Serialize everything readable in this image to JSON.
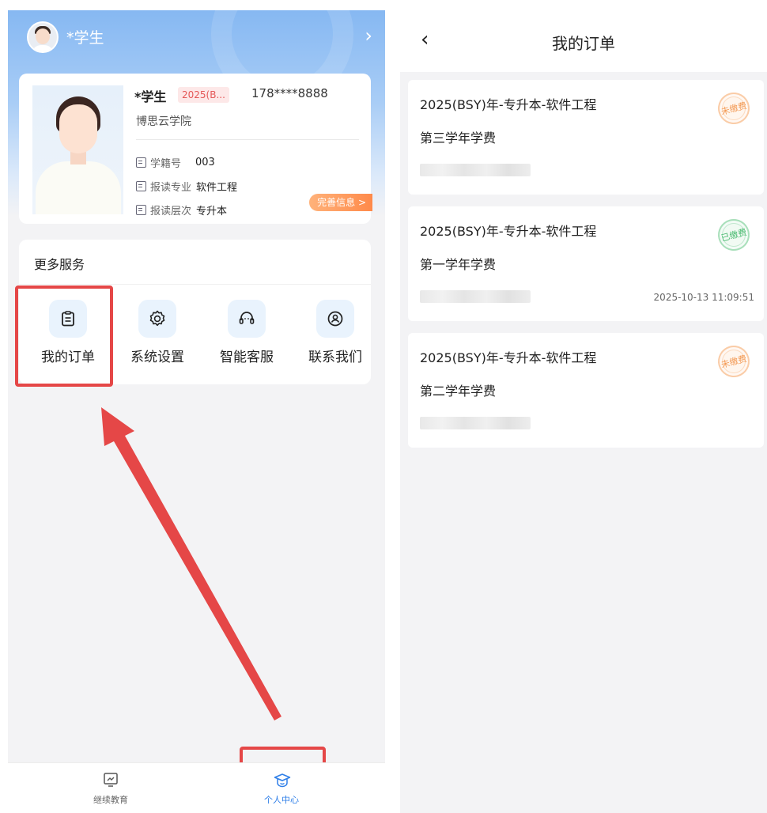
{
  "left": {
    "header": {
      "user_name": "*学生",
      "arrow": "›"
    },
    "profile": {
      "name": "*学生",
      "tag": "2025(B...",
      "phone": "178****8888",
      "school": "博思云学院",
      "rows": [
        {
          "label": "学籍号",
          "value": "003"
        },
        {
          "label": "报读专业",
          "value": "软件工程"
        },
        {
          "label": "报读层次",
          "value": "专升本"
        }
      ],
      "complete_button": "完善信息 >"
    },
    "services": {
      "title": "更多服务",
      "items": [
        {
          "label": "我的订单",
          "icon": "clipboard-icon"
        },
        {
          "label": "系统设置",
          "icon": "gear-icon"
        },
        {
          "label": "智能客服",
          "icon": "headset-icon"
        },
        {
          "label": "联系我们",
          "icon": "contact-icon"
        }
      ]
    },
    "tabbar": {
      "tabs": [
        {
          "label": "继续教育",
          "icon": "monitor-icon",
          "active": false
        },
        {
          "label": "个人中心",
          "icon": "graduation-cap-icon",
          "active": true
        }
      ]
    },
    "annotation_color": "#e54747",
    "accent_color": "#2f7fe8"
  },
  "right": {
    "nav": {
      "back": "‹",
      "title": "我的订单"
    },
    "orders": [
      {
        "title": "2025(BSY)年-专升本-软件工程",
        "subtitle": "第三学年学费",
        "status": "未缴费",
        "date": ""
      },
      {
        "title": "2025(BSY)年-专升本-软件工程",
        "subtitle": "第一学年学费",
        "status": "已缴费",
        "date": "2025-10-13 11:09:51"
      },
      {
        "title": "2025(BSY)年-专升本-软件工程",
        "subtitle": "第二学年学费",
        "status": "未缴费",
        "date": ""
      }
    ]
  }
}
